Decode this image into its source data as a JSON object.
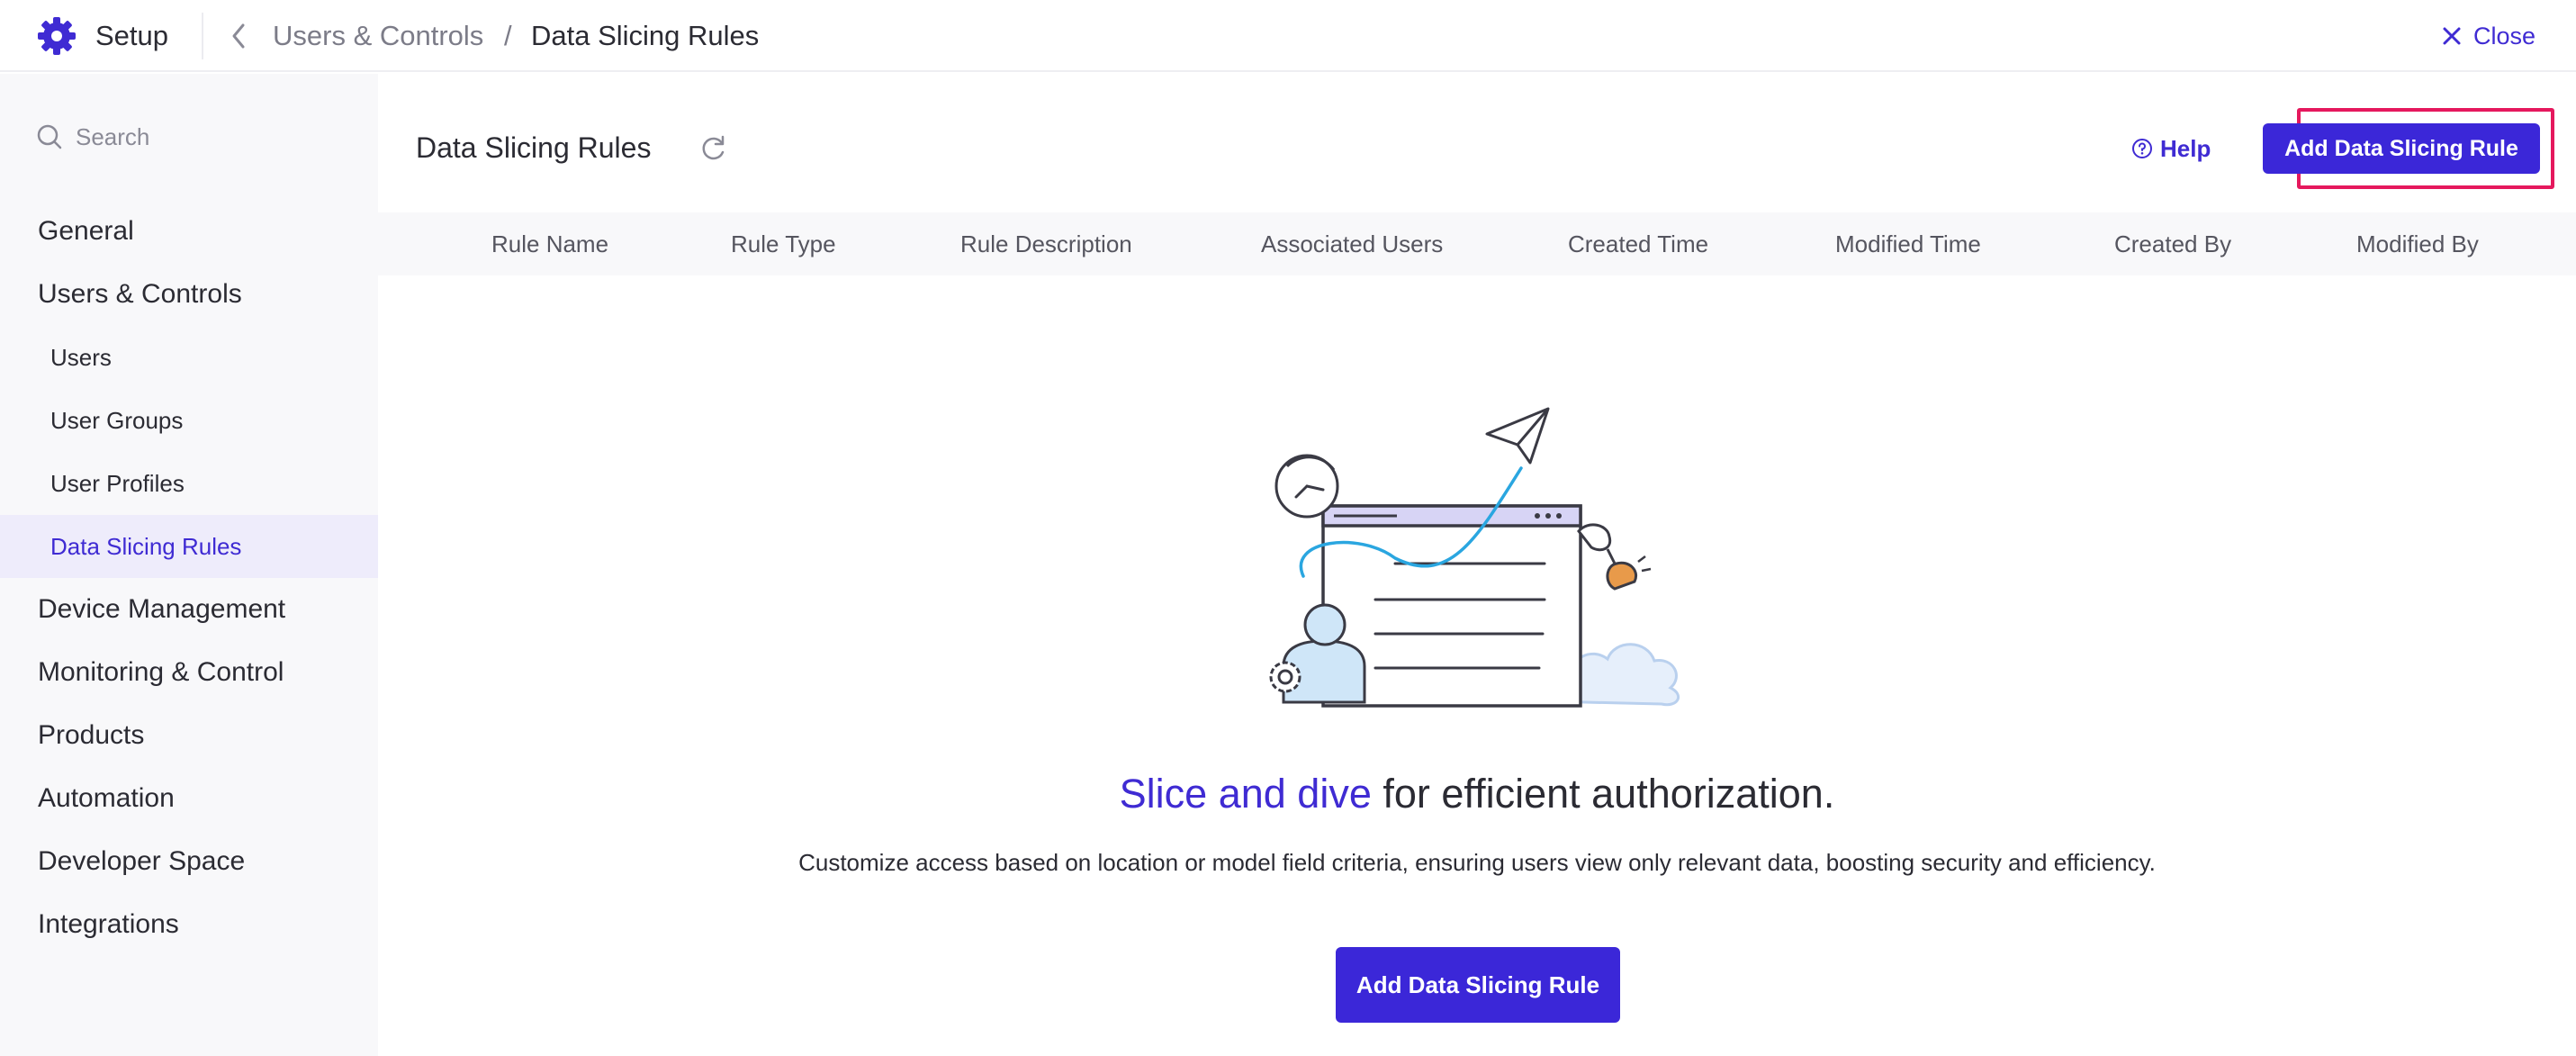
{
  "header": {
    "app_name": "Setup",
    "breadcrumb_parent": "Users & Controls",
    "breadcrumb_separator": "/",
    "breadcrumb_current": "Data Slicing Rules",
    "close_label": "Close"
  },
  "sidebar": {
    "search_placeholder": "Search",
    "items": [
      {
        "label": "General",
        "level": 1
      },
      {
        "label": "Users & Controls",
        "level": 1
      },
      {
        "label": "Users",
        "level": 2
      },
      {
        "label": "User Groups",
        "level": 2
      },
      {
        "label": "User Profiles",
        "level": 2
      },
      {
        "label": "Data Slicing Rules",
        "level": 2,
        "active": true
      },
      {
        "label": "Device Management",
        "level": 1
      },
      {
        "label": "Monitoring & Control",
        "level": 1
      },
      {
        "label": "Products",
        "level": 1
      },
      {
        "label": "Automation",
        "level": 1
      },
      {
        "label": "Developer Space",
        "level": 1
      },
      {
        "label": "Integrations",
        "level": 1
      }
    ]
  },
  "main": {
    "title": "Data Slicing Rules",
    "help_label": "Help",
    "add_button_label": "Add Data Slicing Rule",
    "columns": [
      "Rule Name",
      "Rule Type",
      "Rule Description",
      "Associated Users",
      "Created Time",
      "Modified Time",
      "Created By",
      "Modified By"
    ]
  },
  "empty_state": {
    "headline_accent": "Slice and dive",
    "headline_rest": " for efficient authorization.",
    "description": "Customize access based on location or model field criteria, ensuring users view only relevant data, boosting security and efficiency.",
    "button_label": "Add Data Slicing Rule"
  },
  "colors": {
    "accent": "#3f2bd3",
    "button": "#3b27d8",
    "highlight_border": "#e5185d",
    "sidebar_bg": "#f8f8fa",
    "active_item_bg": "#eeecfb"
  }
}
